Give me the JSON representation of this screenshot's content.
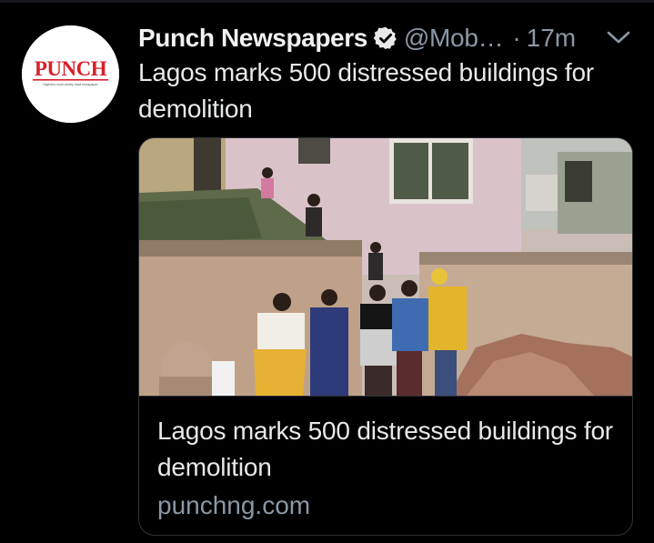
{
  "tweet": {
    "display_name": "Punch Newspapers",
    "handle": "@Mob…",
    "separator": "·",
    "time": "17m",
    "text": "Lagos marks 500 distressed buildings for demolition",
    "avatar": {
      "logo_text": "PUNCH",
      "tagline": "Nigeria's most widely read newspaper"
    },
    "verified_icon": "verified-badge-icon",
    "menu_icon": "chevron-down-icon"
  },
  "card": {
    "title": "Lagos marks 500 distressed buildings for demolition",
    "domain": "punchng.com",
    "image_icon": "news-photo-image"
  },
  "colors": {
    "background": "#000000",
    "primary_text": "#e7e9ea",
    "secondary_text": "#8b98a5",
    "border": "#2f3336",
    "brand_red": "#d6202a"
  }
}
